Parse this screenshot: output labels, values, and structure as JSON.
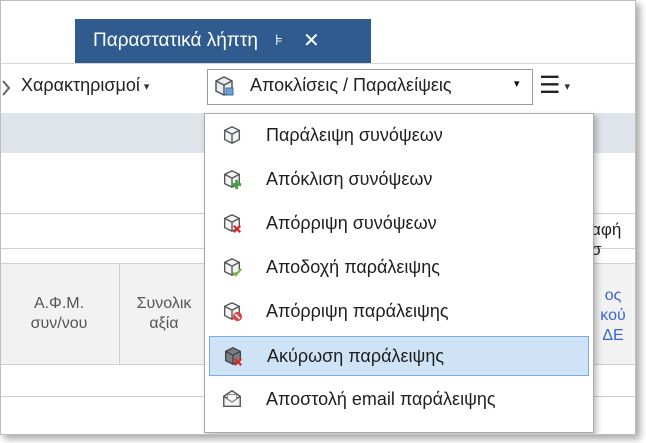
{
  "tab": {
    "title": "Παραστατικά λήπτη",
    "pin_glyph": "⊧",
    "close_glyph": "✕"
  },
  "toolbar": {
    "characterizations_label": "Χαρακτηρισμοί",
    "rejections_label": "Αποκλίσεις / Παραλείψεις",
    "menu_glyph": "☰",
    "caret": "▾"
  },
  "field": {
    "partial_text": "αφή σ"
  },
  "grid": {
    "columns": [
      {
        "line1": "Α.Φ.Μ.",
        "line2": "συν/νου"
      },
      {
        "line1": "Συνολικ",
        "line2": "αξία"
      },
      {
        "line1": "ος",
        "line2": "κού",
        "line3": "ΔΕ"
      }
    ]
  },
  "dropdown": {
    "items": [
      {
        "label": "Παράλειψη συνόψεων",
        "icon": "cube-icon"
      },
      {
        "label": "Απόκλιση συνόψεων",
        "icon": "cube-plus-icon"
      },
      {
        "label": "Απόρριψη συνόψεων",
        "icon": "cube-x-icon"
      },
      {
        "label": "Αποδοχή παράλειψης",
        "icon": "cube-check-icon"
      },
      {
        "label": "Απόρριψη παράλειψης",
        "icon": "cube-cancel-icon"
      },
      {
        "label": "Ακύρωση παράλειψης",
        "icon": "cube-void-icon",
        "selected": true
      },
      {
        "label": "Αποστολή email παράλειψης",
        "icon": "email-icon"
      }
    ]
  },
  "colors": {
    "tab_active": "#2f5b8e",
    "band": "#dfe4ea",
    "selected_bg": "#cfe3f7",
    "selected_border": "#7aaee0",
    "link_blue": "#3a64d8"
  }
}
